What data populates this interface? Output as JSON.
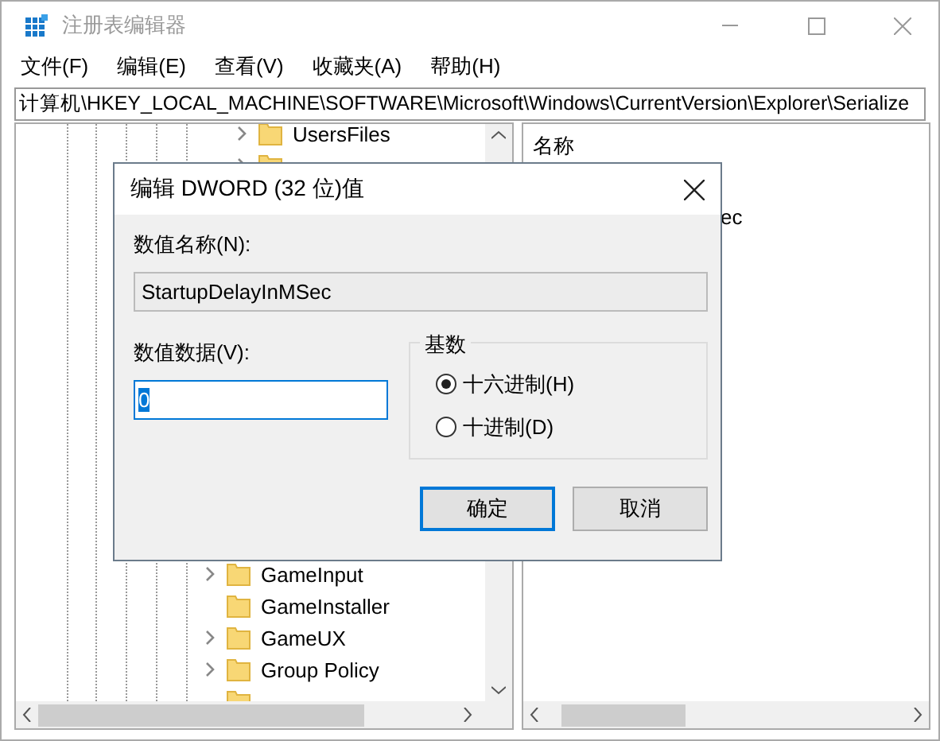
{
  "window": {
    "title": "注册表编辑器"
  },
  "menu": [
    "文件(F)",
    "编辑(E)",
    "查看(V)",
    "收藏夹(A)",
    "帮助(H)"
  ],
  "address": "计算机\\HKEY_LOCAL_MACHINE\\SOFTWARE\\Microsoft\\Windows\\CurrentVersion\\Explorer\\Serialize",
  "tree": {
    "items_above_dialog": [
      {
        "label": "UsersFiles",
        "has_children": true
      },
      {
        "has_children": true
      }
    ],
    "items_below_dialog": [
      {
        "label": "GameInput",
        "has_children": true
      },
      {
        "label": "GameInstaller",
        "has_children": false
      },
      {
        "label": "GameUX",
        "has_children": true
      },
      {
        "label": "Group Policy",
        "has_children": true
      },
      {
        "has_children": false
      }
    ]
  },
  "list": {
    "column": "名称",
    "visible_text": "ec"
  },
  "dialog": {
    "title": "编辑 DWORD (32 位)值",
    "name_label": "数值名称(N):",
    "name_value": "StartupDelayInMSec",
    "data_label": "数值数据(V):",
    "data_value": "0",
    "data_value_selected": true,
    "base_label": "基数",
    "bases": [
      {
        "label": "十六进制(H)",
        "selected": true
      },
      {
        "label": "十进制(D)",
        "selected": false
      }
    ],
    "buttons": [
      {
        "label": "确定",
        "default": true
      },
      {
        "label": "取消",
        "default": false
      }
    ]
  }
}
